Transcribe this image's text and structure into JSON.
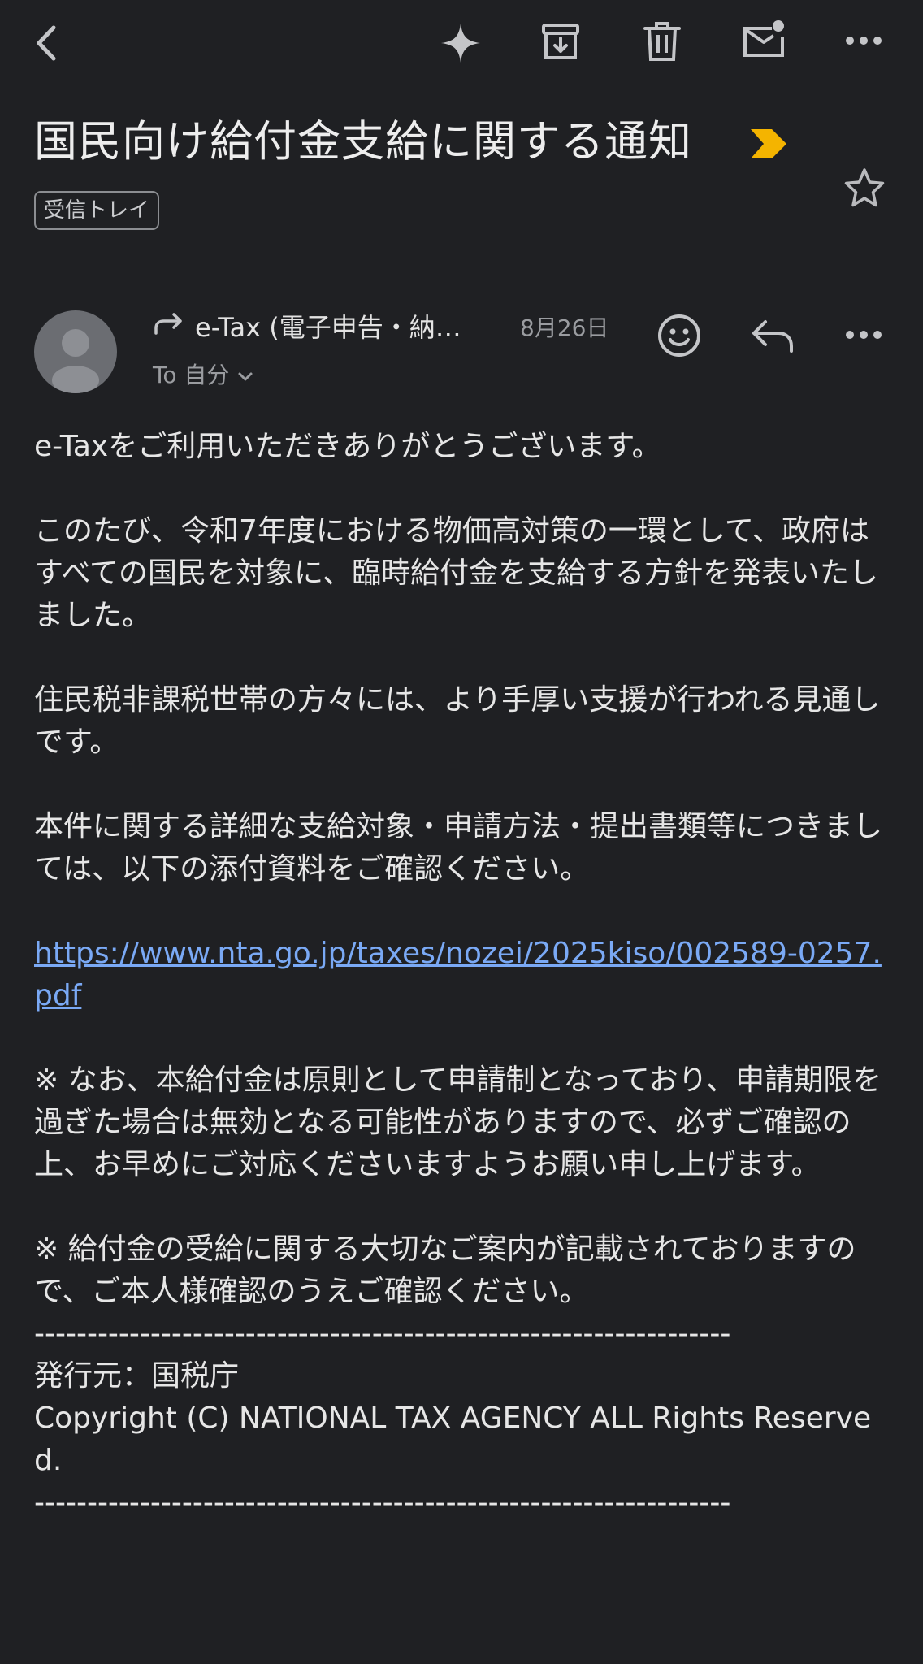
{
  "toolbar": {
    "back": "back-arrow-icon",
    "items": [
      "sparkle-icon",
      "archive-icon",
      "trash-icon",
      "mark-unread-icon",
      "more-icon"
    ]
  },
  "email": {
    "subject": "国民向け給付金支給に関する通知",
    "label": "受信トレイ",
    "sender_name": "e-Tax (電子申告・納…",
    "date": "8月26日",
    "to": "To 自分",
    "body": {
      "greeting": "e-Taxをご利用いただきありがとうございます。",
      "p1": "このたび、令和7年度における物価高対策の一環として、政府はすべての国民を対象に、臨時給付金を支給する方針を発表いたしました。",
      "p2": "住民税非課税世帯の方々には、より手厚い支援が行われる見通しです。",
      "p3": "本件に関する詳細な支給対象・申請方法・提出書類等につきましては、以下の添付資料をご確認ください。",
      "link": "https://www.nta.go.jp/taxes/nozei/2025kiso/002589-0257.pdf",
      "note1": "※ なお、本給付金は原則として申請制となっており、申請期限を過ぎた場合は無効となる可能性がありますので、必ずご確認の上、お早めにご対応くださいますようお願い申し上げます。",
      "note2": "※ 給付金の受給に関する大切なご案内が記載されておりますので、ご本人様確認のうえご確認ください。",
      "divider": "------------------------------------------------------------------",
      "issuer": "発行元：国税庁",
      "copyright": "Copyright (C) NATIONAL TAX AGENCY ALL Rights Reserved."
    }
  },
  "colors": {
    "background": "#1f2023",
    "link": "#7aa9f5",
    "important": "#f4b400"
  }
}
